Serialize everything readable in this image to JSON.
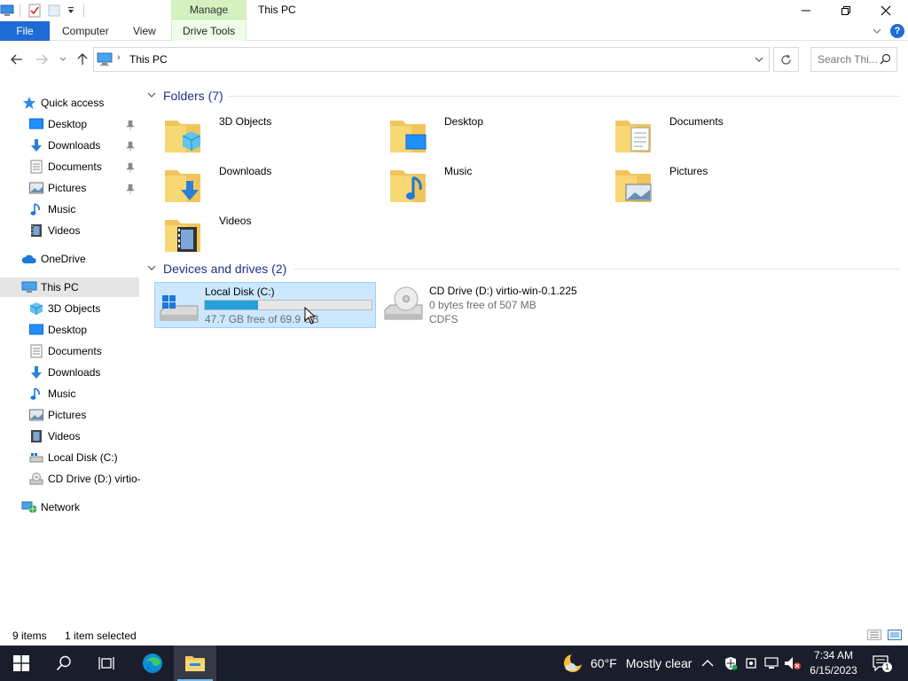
{
  "window": {
    "title": "This PC",
    "contextual_tab": "Manage"
  },
  "ribbon": {
    "tabs": [
      "File",
      "Computer",
      "View",
      "Drive Tools"
    ]
  },
  "address": {
    "path": "This PC",
    "search_placeholder": "Search Thi..."
  },
  "nav": {
    "quick_access": "Quick access",
    "quick_items": [
      "Desktop",
      "Downloads",
      "Documents",
      "Pictures",
      "Music",
      "Videos"
    ],
    "onedrive": "OneDrive",
    "this_pc": "This PC",
    "pc_items": [
      "3D Objects",
      "Desktop",
      "Documents",
      "Downloads",
      "Music",
      "Pictures",
      "Videos",
      "Local Disk (C:)",
      "CD Drive (D:) virtio-"
    ],
    "network": "Network"
  },
  "content": {
    "folders_header": "Folders (7)",
    "folders": [
      "3D Objects",
      "Desktop",
      "Documents",
      "Downloads",
      "Music",
      "Pictures",
      "Videos"
    ],
    "devices_header": "Devices and drives (2)",
    "drives": [
      {
        "name": "Local Disk (C:)",
        "free": "47.7 GB free of 69.9 GB",
        "used_fraction": 0.318
      },
      {
        "name": "CD Drive (D:) virtio-win-0.1.225",
        "free": "0 bytes free of 507 MB",
        "fs": "CDFS"
      }
    ]
  },
  "status": {
    "items": "9 items",
    "selected": "1 item selected"
  },
  "taskbar": {
    "weather_temp": "60°F",
    "weather_desc": "Mostly clear",
    "time": "7:34 AM",
    "date": "6/15/2023",
    "notification_count": "1"
  },
  "colors": {
    "accent": "#1e6bd6",
    "selection": "#cce8ff",
    "progress": "#26a0da",
    "group_header": "#1e3287",
    "manage_tab": "#d4f1c0",
    "taskbar": "#1a1d2b"
  }
}
